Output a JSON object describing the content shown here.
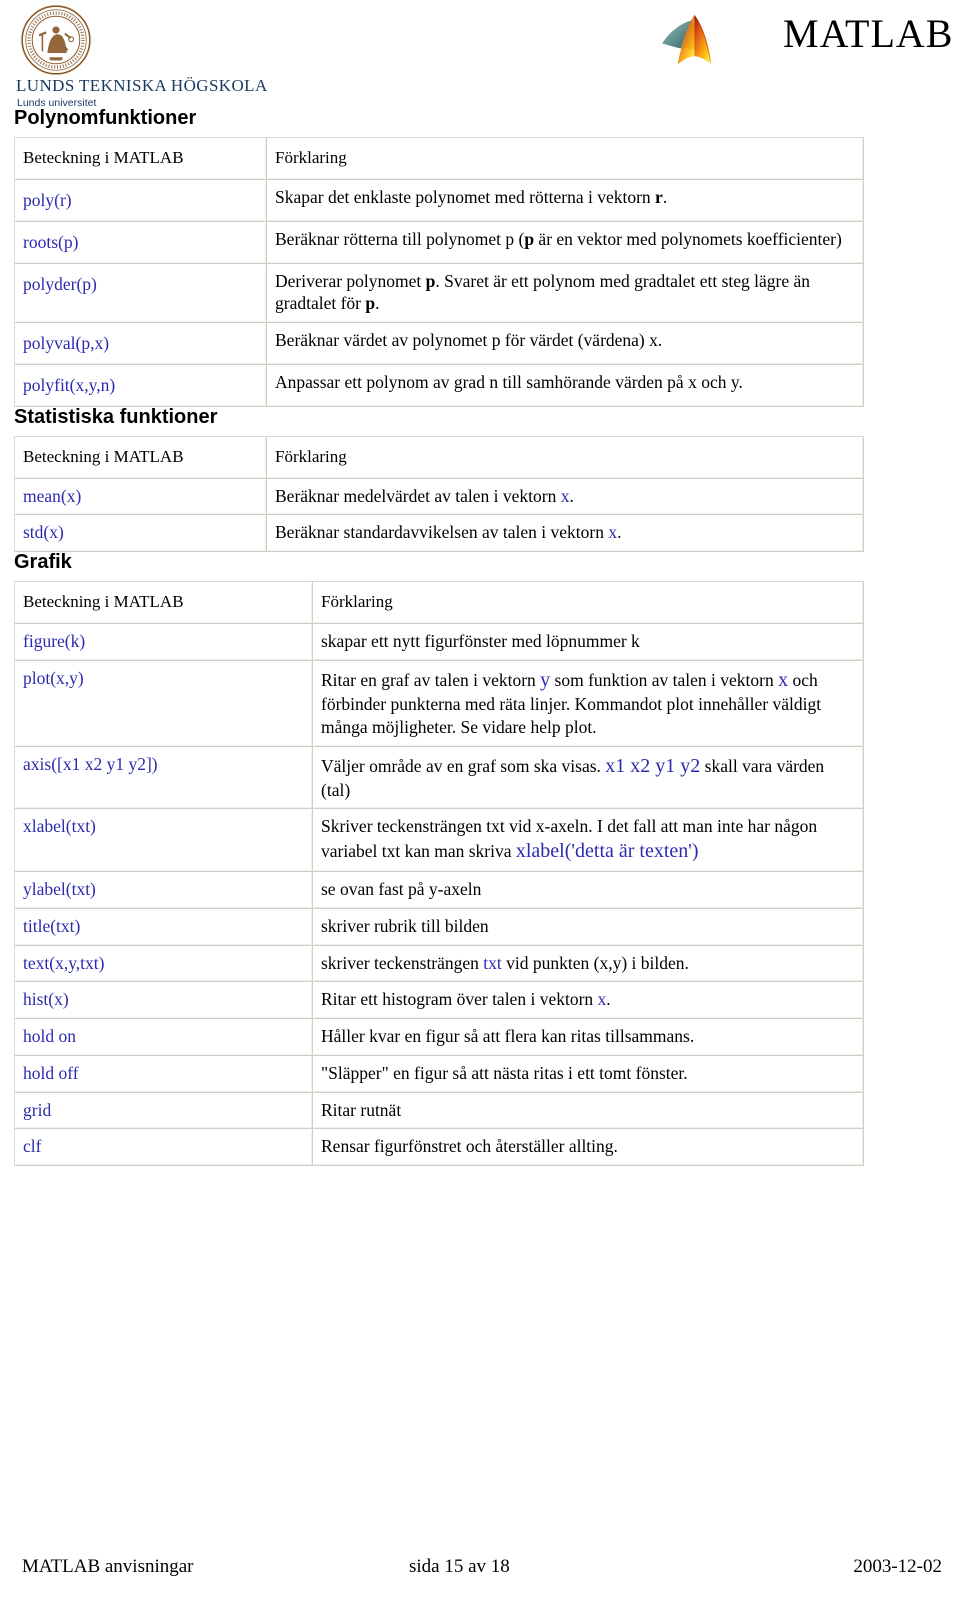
{
  "header": {
    "university_name": "LUNDS TEKNISKA HÖGSKOLA",
    "university_sub": "Lunds universitet",
    "seal_icon": "lund-university-seal-icon",
    "matlab_logo_icon": "matlab-membrane-icon",
    "matlab_wordmark": "MATLAB",
    "colors": {
      "seal": "#8a5a2b",
      "university_text": "#1b3a63",
      "code_blue": "#2b2bb0"
    }
  },
  "sections": [
    {
      "id": "polynomfunktioner",
      "title": "Polynomfunktioner",
      "columns": [
        "Beteckning i MATLAB",
        "Förklaring"
      ],
      "rows": [
        {
          "name": "poly(r)",
          "desc_html": "Skapar det enklaste polynomet med rötterna i vektorn <b>r</b>.",
          "desc_text": "Skapar det enklaste polynomet med rötterna i vektorn r."
        },
        {
          "name": "roots(p)",
          "desc_html": "Beräknar rötterna till polynomet p (<b>p</b> är en vektor med polynomets koefficienter)",
          "desc_text": "Beräknar rötterna till polynomet p (p är en vektor med polynomets koefficienter)"
        },
        {
          "name": "polyder(p)",
          "desc_html": "Deriverar polynomet <b>p</b>. Svaret är ett polynom med gradtalet ett steg lägre än gradtalet för <b>p</b>.",
          "desc_text": "Deriverar polynomet p. Svaret är ett polynom med gradtalet ett steg lägre än gradtalet för p."
        },
        {
          "name": "polyval(p,x)",
          "desc_html": "Beräknar värdet av polynomet p för värdet (värdena) x.",
          "desc_text": "Beräknar värdet av polynomet p för värdet (värdena) x."
        },
        {
          "name": "polyfit(x,y,n)",
          "desc_html": "Anpassar ett polynom av grad n till samhörande värden på x och y.",
          "desc_text": "Anpassar ett polynom av grad n till samhörande värden på x och y."
        }
      ]
    },
    {
      "id": "statistiska-funktioner",
      "title": "Statistiska funktioner",
      "columns": [
        "Beteckning i MATLAB",
        "Förklaring"
      ],
      "rows": [
        {
          "name": "mean(x)",
          "desc_html": "Beräknar medelvärdet av talen i vektorn <span class=\"code\">x</span>.",
          "desc_text": "Beräknar medelvärdet av talen i vektorn x."
        },
        {
          "name": "std(x)",
          "desc_html": "Beräknar standardavvikelsen av talen i vektorn <span class=\"code\">x</span>.",
          "desc_text": "Beräknar standardavvikelsen av talen i vektorn x."
        }
      ]
    },
    {
      "id": "grafik",
      "title": "Grafik",
      "columns": [
        "Beteckning i MATLAB",
        "Förklaring"
      ],
      "rows": [
        {
          "name": "figure(k)",
          "desc_html": "skapar ett nytt figurfönster med löpnummer k",
          "desc_text": "skapar ett nytt figurfönster med löpnummer k"
        },
        {
          "name": "plot(x,y)",
          "desc_html": "Ritar en graf av talen i vektorn <span class=\"code-lg\">y</span> som funktion av talen i vektorn <span class=\"code-lg\">x</span> och förbinder punkterna med räta linjer. Kommandot plot innehåller väldigt många möjligheter. Se vidare help plot.",
          "desc_text": "Ritar en graf av talen i vektorn y som funktion av talen i vektorn x och förbinder punkterna med räta linjer. Kommandot plot innehåller väldigt många möjligheter. Se vidare help plot."
        },
        {
          "name": "axis([x1 x2 y1 y2])",
          "desc_html": "Väljer område av en graf som ska visas. <span class=\"code-lg\">x1 x2 y1 y2</span> skall vara värden (tal)",
          "desc_text": "Väljer område av en graf som ska visas. x1 x2 y1 y2 skall vara värden (tal)"
        },
        {
          "name": "xlabel(txt)",
          "desc_html": "Skriver teckensträngen txt vid x-axeln. I det fall att man inte har någon variabel txt kan man skriva <span class=\"code-lg\">xlabel('detta är texten')</span>",
          "desc_text": "Skriver teckensträngen txt vid x-axeln. I det fall att man inte har någon variabel txt kan man skriva xlabel('detta är texten')"
        },
        {
          "name": "ylabel(txt)",
          "desc_html": "se ovan fast på y-axeln",
          "desc_text": "se ovan fast på y-axeln"
        },
        {
          "name": "title(txt)",
          "desc_html": "skriver rubrik till bilden",
          "desc_text": "skriver rubrik till bilden"
        },
        {
          "name": "text(x,y,txt)",
          "desc_html": "skriver teckensträngen <span class=\"code\">txt</span> vid punkten (x,y) i bilden.",
          "desc_text": "skriver teckensträngen txt vid punkten (x,y) i bilden."
        },
        {
          "name": "hist(x)",
          "desc_html": "Ritar ett histogram över talen i vektorn <span class=\"code\">x</span>.",
          "desc_text": "Ritar ett histogram över talen i vektorn x."
        },
        {
          "name": "hold on",
          "desc_html": "Håller kvar en figur så att flera kan ritas tillsammans.",
          "desc_text": "Håller kvar en figur så att flera kan ritas tillsammans."
        },
        {
          "name": "hold off",
          "desc_html": "\"Släpper\" en figur så att nästa ritas i ett tomt fönster.",
          "desc_text": "\"Släpper\" en figur så att nästa ritas i ett tomt fönster."
        },
        {
          "name": "grid",
          "desc_html": "Ritar rutnät",
          "desc_text": "Ritar rutnät"
        },
        {
          "name": "clf",
          "desc_html": "Rensar figurfönstret och återställer allting.",
          "desc_text": "Rensar figurfönstret och återställer allting."
        }
      ]
    }
  ],
  "footer": {
    "left": "MATLAB anvisningar",
    "center": "sida 15 av 18",
    "right": "2003-12-02"
  }
}
